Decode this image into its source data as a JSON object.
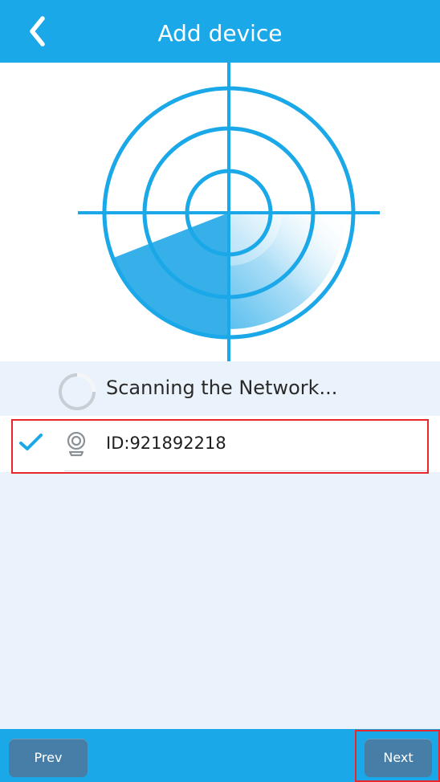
{
  "header": {
    "title": "Add device"
  },
  "scan": {
    "status_text": "Scanning the Network..."
  },
  "devices": [
    {
      "label": "ID:921892218",
      "selected": true
    }
  ],
  "footer": {
    "prev_label": "Prev",
    "next_label": "Next"
  },
  "colors": {
    "primary": "#1aa8e8",
    "button": "#477ea8",
    "highlight": "#e8262b",
    "background": "#eaf3fb"
  },
  "icons": {
    "back": "chevron-left-icon",
    "radar": "radar-icon",
    "spinner": "loading-spinner-icon",
    "check": "check-icon",
    "camera": "webcam-icon"
  }
}
